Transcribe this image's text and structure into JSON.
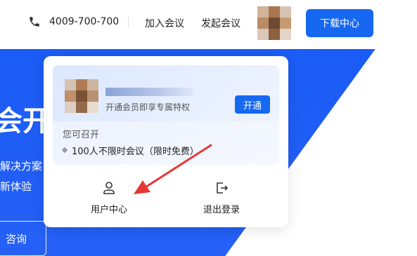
{
  "header": {
    "phone": "4009-700-700",
    "nav": [
      "加入会议",
      "发起会议"
    ],
    "download_label": "下载中心"
  },
  "hero": {
    "headline_partial": "会开",
    "line1_partial": "解决方案",
    "line2_partial": "新体验",
    "button_partial": "咨询"
  },
  "popover": {
    "member_tip": "开通会员即享专属特权",
    "open_label": "开通",
    "can_label": "您可召开",
    "perk": "100人不限时会议（限时免费）",
    "actions": [
      {
        "label": "用户中心",
        "icon": "user-icon"
      },
      {
        "label": "退出登录",
        "icon": "logout-icon"
      }
    ]
  },
  "colors": {
    "primary": "#1768f0",
    "hero_blue": "#1a5cf5",
    "annotation_red": "#e53935"
  }
}
